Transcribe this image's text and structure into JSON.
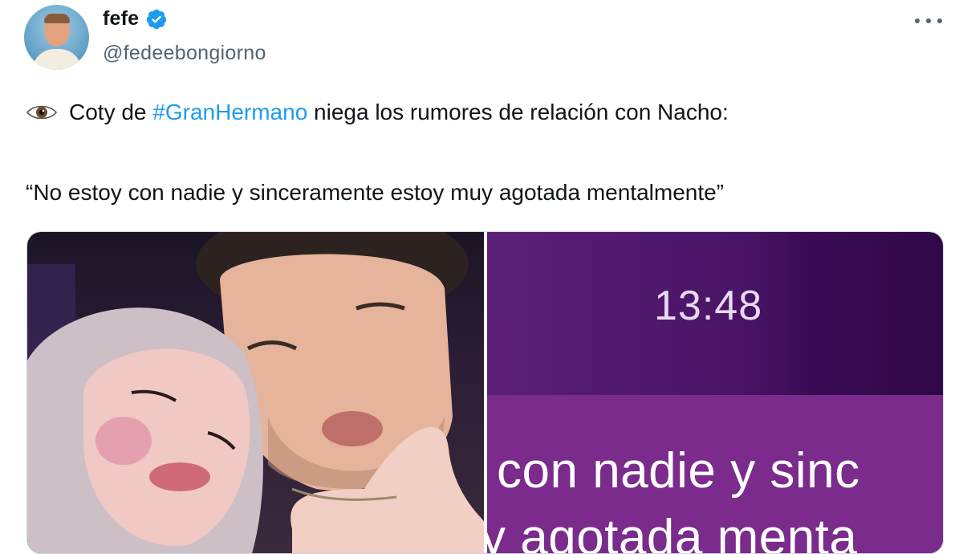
{
  "author": {
    "display_name": "fefe",
    "handle": "@fedeebongiorno",
    "verified": true,
    "avatar_icon": "profile-photo"
  },
  "tweet": {
    "line1_emoji": "eye-icon",
    "line1_pre": "Coty de ",
    "hashtag": "#GranHermano",
    "line1_post": " niega los rumores de relación con Nacho:",
    "line2": "“No estoy con nadie y sinceramente estoy muy agotada mentalmente”"
  },
  "media": {
    "screenshot_time": "13:48",
    "screenshot_text_line1": "con nadie y sinc",
    "screenshot_text_line2": "y agotada menta"
  },
  "colors": {
    "hashtag": "#1d9bf0",
    "verified_badge": "#1d9bf0",
    "secondary_text": "#536471",
    "screenshot_purple": "#7a2b8c"
  }
}
